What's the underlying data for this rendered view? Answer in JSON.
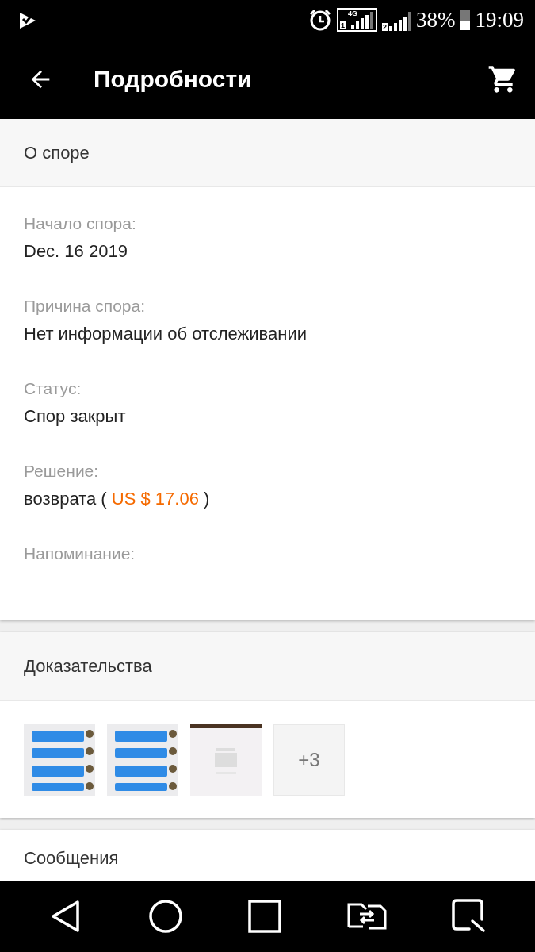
{
  "status_bar": {
    "battery": "38%",
    "time": "19:09",
    "network": "4G",
    "sim_1": "1",
    "sim_2": "2"
  },
  "app_bar": {
    "title": "Подробности"
  },
  "dispute": {
    "title": "О споре",
    "fields": [
      {
        "label": "Начало спора:",
        "value": "Dec. 16 2019"
      },
      {
        "label": "Причина спора:",
        "value": "Нет информации об отслеживании"
      },
      {
        "label": "Статус:",
        "value": "Спор закрыт"
      },
      {
        "label": "Решение:",
        "value": "возврата (",
        "amount": "US $ 17.06",
        "closing": ")"
      },
      {
        "label": "Напоминание:"
      }
    ]
  },
  "evidence": {
    "title": "Доказательства",
    "thumbnails": [
      {
        "kind": "chat"
      },
      {
        "kind": "chat"
      },
      {
        "kind": "store"
      }
    ],
    "more": "+3"
  },
  "messages": {
    "title": "Сообщения"
  }
}
